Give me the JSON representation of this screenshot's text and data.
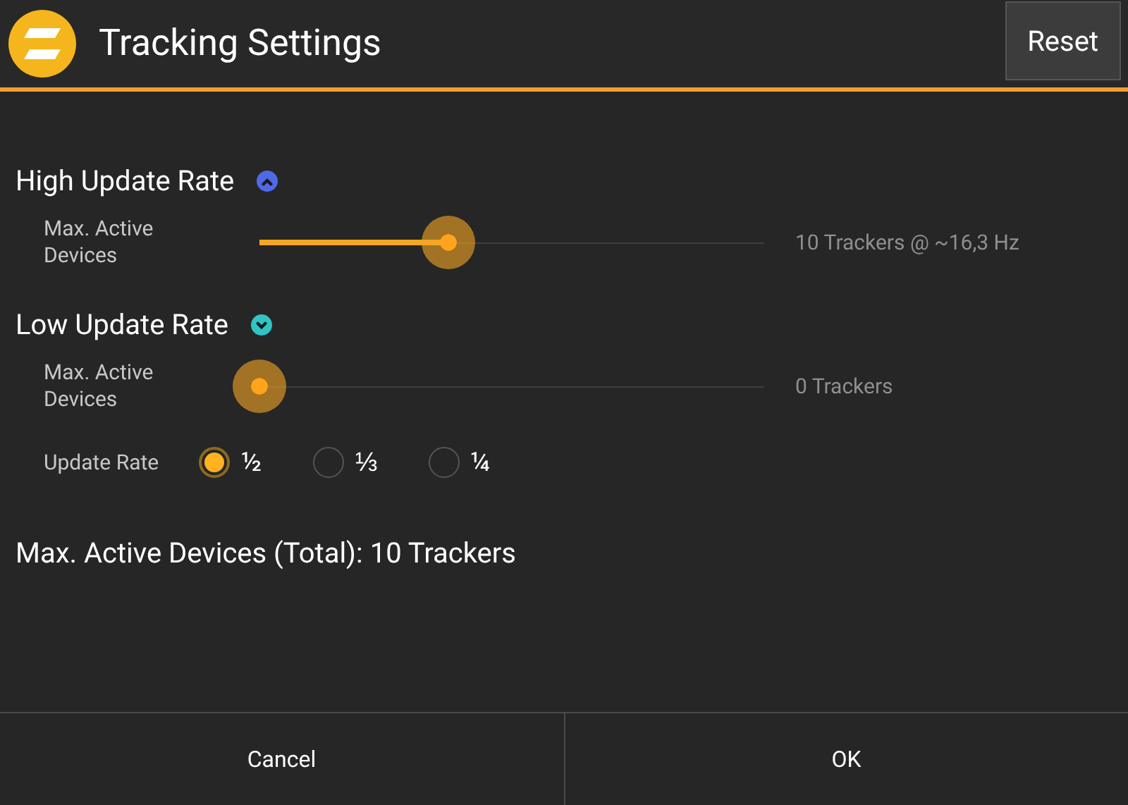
{
  "header": {
    "title": "Tracking Settings",
    "reset_button": "Reset"
  },
  "sections": [
    {
      "title": "High Update Rate",
      "kind": "up",
      "color": "#4f6ae6",
      "rows": [
        {
          "kind": "slider",
          "label": "Max. Active Devices",
          "level": 0.374,
          "reading": "10 Trackers @ ~16,3 Hz"
        }
      ]
    },
    {
      "title": "Low Update Rate",
      "kind": "down",
      "color": "#2fc5c5",
      "rows": [
        {
          "kind": "slider",
          "label": "Max. Active Devices",
          "level": 0,
          "reading": "0 Trackers"
        },
        {
          "kind": "radio",
          "label": "Update Rate",
          "options": [
            {
              "label": "½",
              "selected": true
            },
            {
              "label": "⅓",
              "selected": false
            },
            {
              "label": "¼",
              "selected": false
            }
          ]
        }
      ]
    }
  ],
  "total": "Max. Active Devices (Total): 10 Trackers",
  "buttons": [
    "Cancel",
    "OK"
  ]
}
